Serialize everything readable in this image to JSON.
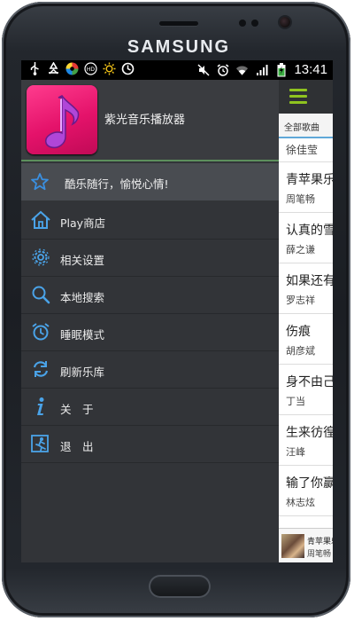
{
  "device": {
    "brand": "SAMSUNG"
  },
  "statusbar": {
    "left_icons": [
      "usb-icon",
      "recycle-icon",
      "color-wheel-icon",
      "hd-icon",
      "sun-icon",
      "sync-icon"
    ],
    "right_icons": [
      "mute-icon",
      "alarm-icon",
      "wifi-icon",
      "signal-icon",
      "battery-charging-icon"
    ],
    "time": "13:41"
  },
  "drawer": {
    "app_title": "紫光音乐播放器",
    "motto": "酷乐随行，愉悦心情!",
    "menu": [
      {
        "label": "Play商店",
        "icon": "house-icon"
      },
      {
        "label": "相关设置",
        "icon": "gear-icon"
      },
      {
        "label": "本地搜索",
        "icon": "search-icon"
      },
      {
        "label": "睡眠模式",
        "icon": "alarm-clock-icon"
      },
      {
        "label": "刷新乐库",
        "icon": "refresh-icon"
      },
      {
        "label": "关　于",
        "icon": "info-icon"
      },
      {
        "label": "退　出",
        "icon": "exit-icon"
      }
    ]
  },
  "main": {
    "tab_label": "全部歌曲",
    "songs": [
      {
        "title": "",
        "artist": "徐佳莹"
      },
      {
        "title": "青苹果乐园",
        "artist": "周笔畅"
      },
      {
        "title": "认真的雪",
        "artist": "薛之谦"
      },
      {
        "title": "如果还有明天",
        "artist": "罗志祥"
      },
      {
        "title": "伤痕",
        "artist": "胡彦斌"
      },
      {
        "title": "身不由己",
        "artist": "丁当"
      },
      {
        "title": "生来彷徨",
        "artist": "汪峰"
      },
      {
        "title": "输了你赢了世界",
        "artist": "林志炫"
      }
    ],
    "player": {
      "title": "青苹果乐园",
      "artist": "周笔畅"
    }
  },
  "colors": {
    "accent_green": "#8fc31f",
    "app_icon_pink": "#e4126a",
    "tab_blue": "#5fa8d8"
  }
}
